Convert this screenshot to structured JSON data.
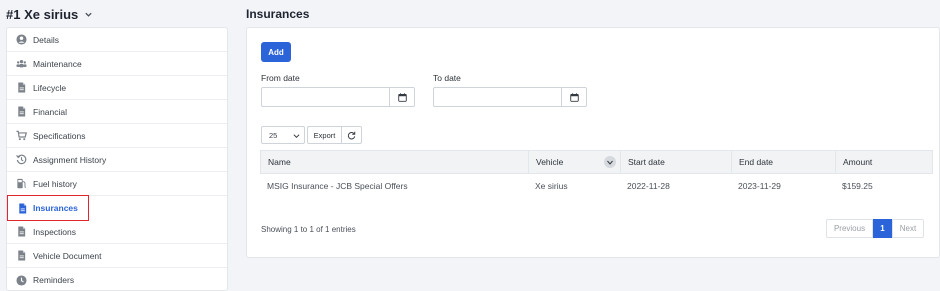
{
  "vehicle": {
    "title": "#1 Xe sirius"
  },
  "sidebar": {
    "items": [
      {
        "label": "Details",
        "icon": "user-circle-icon"
      },
      {
        "label": "Maintenance",
        "icon": "users-icon"
      },
      {
        "label": "Lifecycle",
        "icon": "document-icon"
      },
      {
        "label": "Financial",
        "icon": "document-icon"
      },
      {
        "label": "Specifications",
        "icon": "cart-icon"
      },
      {
        "label": "Assignment History",
        "icon": "history-icon"
      },
      {
        "label": "Fuel history",
        "icon": "fuel-pump-icon"
      },
      {
        "label": "Insurances",
        "icon": "document-icon",
        "active": true
      },
      {
        "label": "Inspections",
        "icon": "document-icon"
      },
      {
        "label": "Vehicle Document",
        "icon": "document-icon"
      },
      {
        "label": "Reminders",
        "icon": "clock-icon"
      }
    ]
  },
  "main": {
    "title": "Insurances",
    "add_label": "Add",
    "from_date": {
      "label": "From date",
      "value": ""
    },
    "to_date": {
      "label": "To date",
      "value": ""
    },
    "page_length": "25",
    "export_label": "Export",
    "table": {
      "columns": [
        "Name",
        "Vehicle",
        "Start date",
        "End date",
        "Amount"
      ],
      "rows": [
        [
          "MSIG Insurance - JCB Special Offers",
          "Xe sirius",
          "2022-11-28",
          "2023-11-29",
          "$159.25"
        ]
      ]
    },
    "info": "Showing 1 to 1 of 1 entries",
    "pagination": {
      "previous": "Previous",
      "current": "1",
      "next": "Next"
    }
  },
  "colors": {
    "accent": "#2b63d9",
    "highlight": "#e0262e",
    "background": "#f3f4f7"
  }
}
